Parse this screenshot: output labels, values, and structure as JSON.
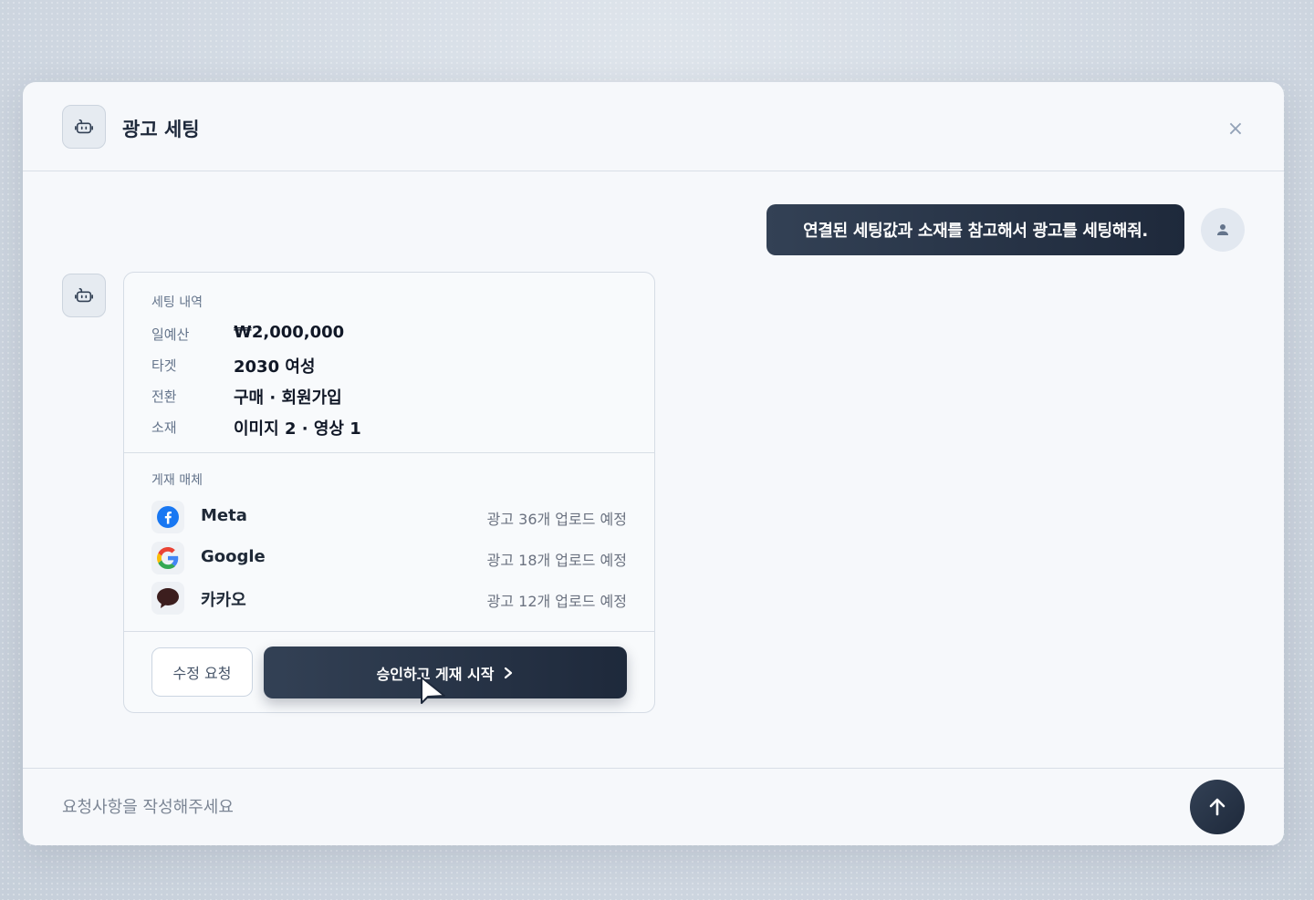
{
  "header": {
    "title": "광고 세팅",
    "bot_icon": "robot-icon",
    "close_glyph": "×"
  },
  "chat": {
    "user_message": "연결된 세팅값과 소재를 참고해서 광고를 세팅해줘.",
    "user_icon": "user-icon",
    "bot_icon": "robot-icon"
  },
  "card": {
    "settings_title": "세팅 내역",
    "settings": [
      {
        "label": "일예산",
        "value": "₩2,000,000"
      },
      {
        "label": "타겟",
        "value": "2030 여성"
      },
      {
        "label": "전환",
        "value": "구매 · 회원가입"
      },
      {
        "label": "소재",
        "value": "이미지 2 · 영상 1"
      }
    ],
    "platforms_title": "게재 매체",
    "platforms": [
      {
        "name": "Meta",
        "note": "광고 36개 업로드 예정",
        "icon": "facebook-icon",
        "color": "#1877F2"
      },
      {
        "name": "Google",
        "note": "광고 18개 업로드 예정",
        "icon": "google-icon",
        "color": "#4285F4"
      },
      {
        "name": "카카오",
        "note": "광고 12개 업로드 예정",
        "icon": "kakao-icon",
        "color": "#3C1E1E"
      }
    ],
    "edit_label": "수정 요청",
    "approve_label": "승인하고 게재 시작"
  },
  "composer": {
    "placeholder": "요청사항을 작성해주세요",
    "value": ""
  },
  "colors": {
    "accent": "#1e293b",
    "background": "#f6f8fb",
    "border": "#d8dee6"
  }
}
